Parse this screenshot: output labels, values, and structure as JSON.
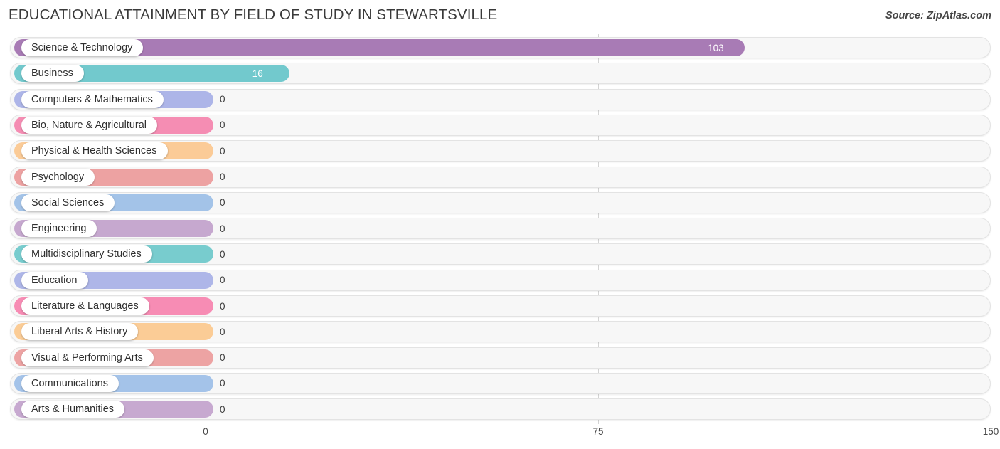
{
  "header": {
    "title": "EDUCATIONAL ATTAINMENT BY FIELD OF STUDY IN STEWARTSVILLE",
    "source": "Source: ZipAtlas.com"
  },
  "chart_data": {
    "type": "bar",
    "orientation": "horizontal",
    "title": "EDUCATIONAL ATTAINMENT BY FIELD OF STUDY IN STEWARTSVILLE",
    "xlabel": "",
    "ylabel": "",
    "xlim": [
      0,
      150
    ],
    "xticks": [
      0,
      75,
      150
    ],
    "xtick_labels": [
      "0",
      "75",
      "150"
    ],
    "grid": true,
    "legend": "none",
    "categories": [
      "Science & Technology",
      "Business",
      "Computers & Mathematics",
      "Bio, Nature & Agricultural",
      "Physical & Health Sciences",
      "Psychology",
      "Social Sciences",
      "Engineering",
      "Multidisciplinary Studies",
      "Education",
      "Literature & Languages",
      "Liberal Arts & History",
      "Visual & Performing Arts",
      "Communications",
      "Arts & Humanities"
    ],
    "values": [
      103,
      16,
      0,
      0,
      0,
      0,
      0,
      0,
      0,
      0,
      0,
      0,
      0,
      0,
      0
    ],
    "value_labels": [
      "103",
      "16",
      "0",
      "0",
      "0",
      "0",
      "0",
      "0",
      "0",
      "0",
      "0",
      "0",
      "0",
      "0",
      "0"
    ],
    "colors": [
      "#a87bb5",
      "#72c9cd",
      "#adb5e8",
      "#f58db3",
      "#fbcb97",
      "#eda2a2",
      "#a3c3e8",
      "#c6a8cf",
      "#78ccce",
      "#aeb6e8",
      "#f78cb4",
      "#fbcc96",
      "#eda3a3",
      "#a4c3e9",
      "#c7a9d0"
    ]
  }
}
